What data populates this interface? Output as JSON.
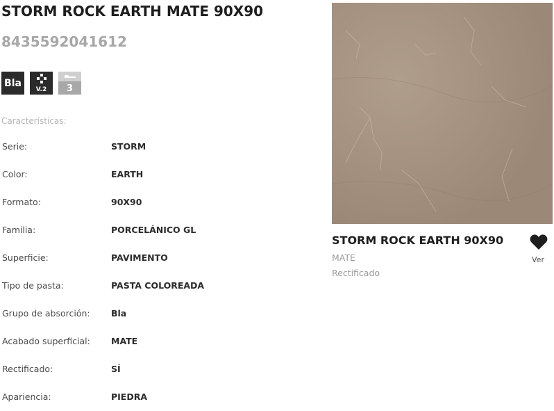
{
  "product": {
    "title": "STORM ROCK EARTH MATE 90X90",
    "ean": "8435592041612"
  },
  "badges": {
    "absorption": "Bla",
    "variation": "V.2",
    "slip": "3"
  },
  "features_label": "Características:",
  "specs": [
    {
      "key": "Serie:",
      "value": "STORM"
    },
    {
      "key": "Color:",
      "value": "EARTH"
    },
    {
      "key": "Formato:",
      "value": "90X90"
    },
    {
      "key": "Familia:",
      "value": "PORCELÁNICO GL"
    },
    {
      "key": "Superficie:",
      "value": "PAVIMENTO"
    },
    {
      "key": "Tipo de pasta:",
      "value": "PASTA COLOREADA"
    },
    {
      "key": "Grupo de absorción:",
      "value": "Bla"
    },
    {
      "key": "Acabado superficial:",
      "value": "MATE"
    },
    {
      "key": "Rectificado:",
      "value": "SÍ"
    },
    {
      "key": "Apariencia:",
      "value": "PIEDRA"
    }
  ],
  "card": {
    "title": "STORM ROCK EARTH 90X90",
    "finish": "MATE",
    "rectified": "Rectificado",
    "favorite_label": "Ver",
    "tile_color": "#a3907f"
  }
}
